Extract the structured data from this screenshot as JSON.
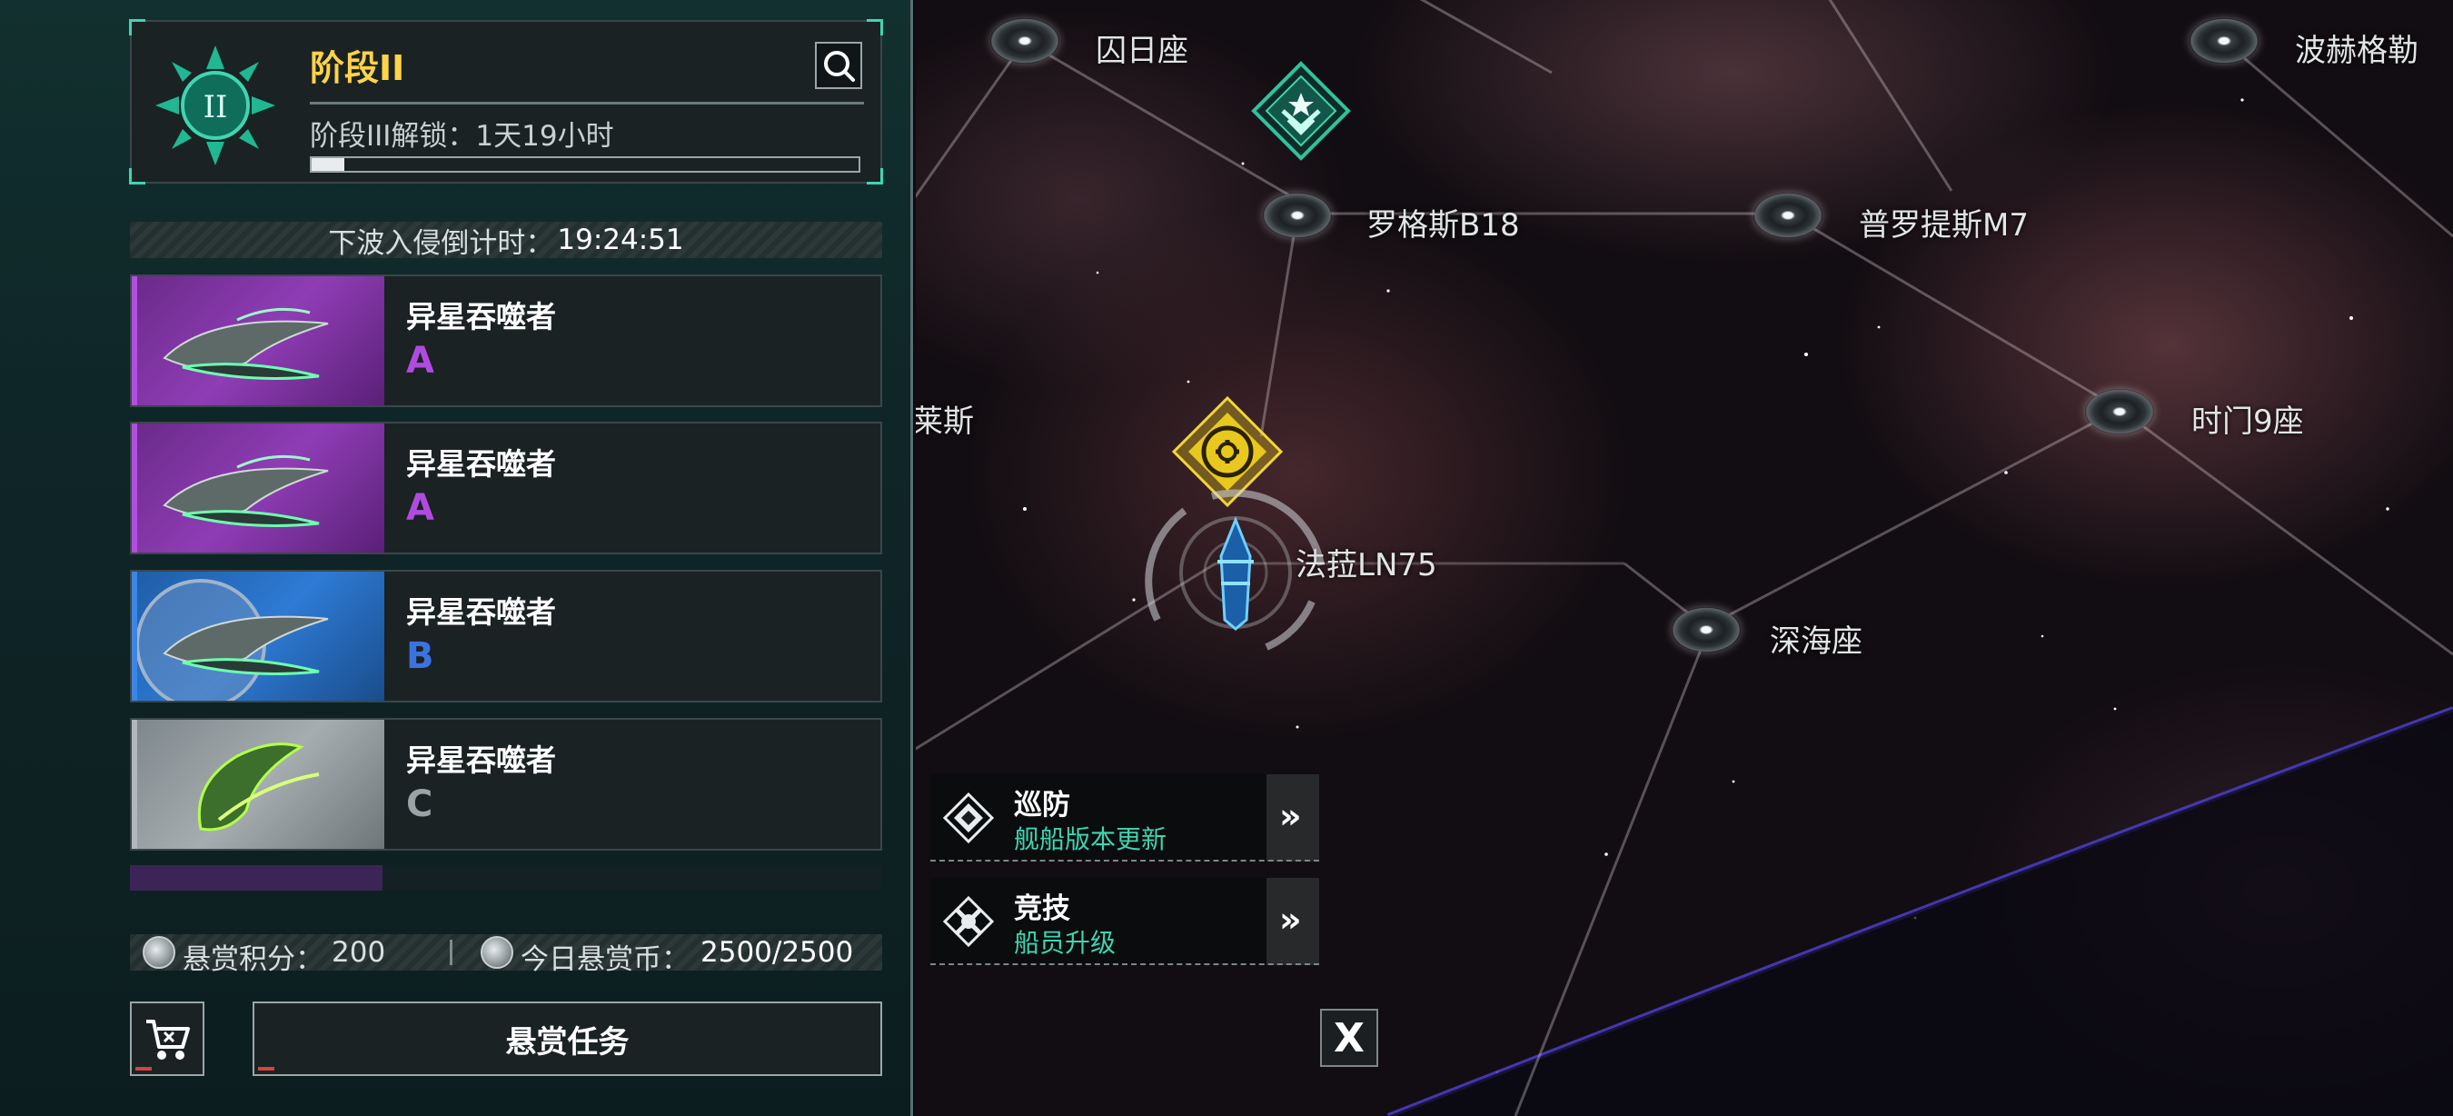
{
  "panel": {
    "stage": {
      "emblem": "II",
      "title": "阶段II",
      "unlock_text": "阶段III解锁：1天19小时",
      "progress": 0.06
    },
    "countdown": {
      "label": "下波入侵倒计时：",
      "value": "19:24:51"
    },
    "targets": [
      {
        "name": "异星吞噬者",
        "grade": "A"
      },
      {
        "name": "异星吞噬者",
        "grade": "A"
      },
      {
        "name": "异星吞噬者",
        "grade": "B"
      },
      {
        "name": "异星吞噬者",
        "grade": "C"
      }
    ],
    "bounty": {
      "points_label": "悬赏积分：",
      "points_value": "200",
      "coins_label": "今日悬赏币：",
      "coins_value": "2500/2500"
    },
    "task_button": "悬赏任务"
  },
  "map": {
    "systems": {
      "qiuri": "囚日座",
      "bohege": "波赫格勒",
      "luoges": "罗格斯B18",
      "puluotis": "普罗提斯M7",
      "laisi": "莱斯",
      "shimen": "时门9座",
      "fala": "法菈LN75",
      "shenhai": "深海座"
    },
    "commands": [
      {
        "title": "巡防",
        "subtitle": "舰船版本更新"
      },
      {
        "title": "竞技",
        "subtitle": "船员升级"
      }
    ],
    "close": "X"
  },
  "colors": {
    "accent_teal": "#3fd5b0",
    "stage_gold": "#ffd447",
    "grade_A": "#b04be0",
    "grade_B": "#3c72e0",
    "grade_C": "#9aa3a6"
  },
  "icons": [
    "search-icon",
    "stage-emblem-icon",
    "coin-icon",
    "shop-cart-icon",
    "patrol-icon",
    "arena-icon",
    "double-chevron-icon",
    "close-icon",
    "rank-badge-icon",
    "mission-marker-icon",
    "player-ship-icon"
  ]
}
